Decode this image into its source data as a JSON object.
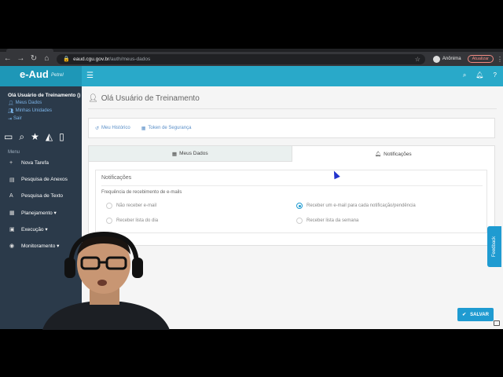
{
  "browser": {
    "url_domain": "eaud.cgu.gov.br",
    "url_path": "/auth/meus-dados",
    "profile_name": "Anônima",
    "update_label": "Atualizar"
  },
  "app": {
    "brand": "e-Aud",
    "brand_sub": "Petrel"
  },
  "sidebar": {
    "greeting": "Olá Usuário de Treinamento ()",
    "links": [
      "Meus Dados",
      "Minhas Unidades",
      "Sair"
    ],
    "menu_label": "Menu",
    "items": [
      {
        "label": "Nova Tarefa",
        "icon": "plus-icon"
      },
      {
        "label": "Pesquisa de Anexos",
        "icon": "file-icon"
      },
      {
        "label": "Pesquisa de Texto",
        "icon": "text-icon"
      },
      {
        "label": "Planejamento ▾",
        "icon": "calendar-icon"
      },
      {
        "label": "Execução ▾",
        "icon": "task-icon"
      },
      {
        "label": "Monitoramento ▾",
        "icon": "eye-icon"
      }
    ]
  },
  "main": {
    "title": "Olá Usuário de Treinamento",
    "links": [
      "Meu Histórico",
      "Token de Segurança"
    ],
    "tabs": [
      "Meus Dados",
      "Notificações"
    ],
    "notif_title": "Notificações",
    "freq_label": "Frequência de recebimento de e-mails",
    "options": [
      {
        "label": "Não receber e-mail",
        "checked": false
      },
      {
        "label": "Receber um e-mail para cada notificação/pendência",
        "checked": true
      },
      {
        "label": "Receber lista do dia",
        "checked": false
      },
      {
        "label": "Receber lista da semana",
        "checked": false
      }
    ],
    "save_label": "SALVAR",
    "feedback_label": "Feedback"
  },
  "colors": {
    "header": "#29a9c9",
    "sidebar": "#2b3a4a",
    "accent": "#1f9bd1"
  }
}
